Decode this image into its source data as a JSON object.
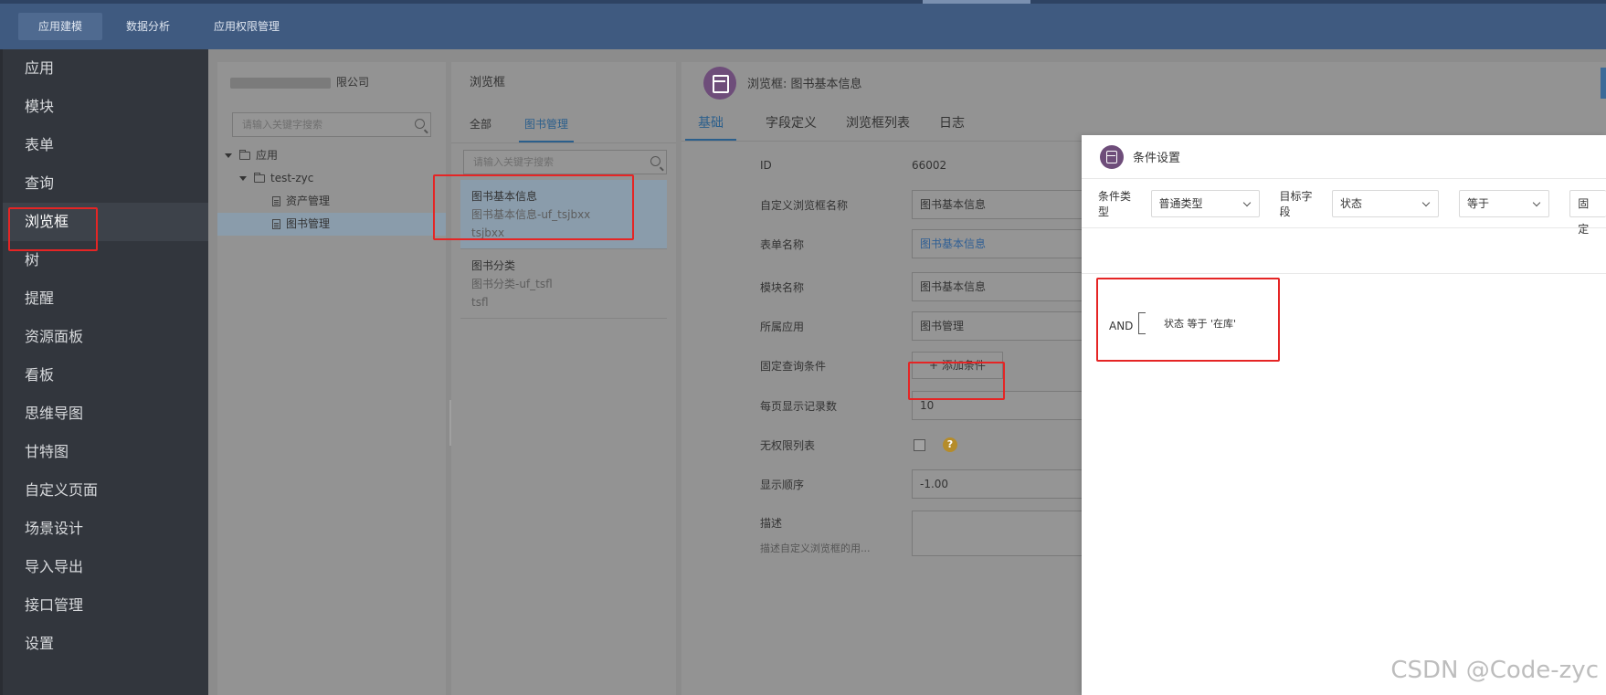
{
  "top_nav": {
    "tabs": [
      {
        "label": "应用建模",
        "active": true
      },
      {
        "label": "数据分析",
        "active": false
      },
      {
        "label": "应用权限管理",
        "active": false
      }
    ]
  },
  "sidebar": {
    "items": [
      {
        "label": "应用"
      },
      {
        "label": "模块"
      },
      {
        "label": "表单"
      },
      {
        "label": "查询"
      },
      {
        "label": "浏览框",
        "active": true
      },
      {
        "label": "树"
      },
      {
        "label": "提醒"
      },
      {
        "label": "资源面板"
      },
      {
        "label": "看板"
      },
      {
        "label": "思维导图"
      },
      {
        "label": "甘特图"
      },
      {
        "label": "自定义页面"
      },
      {
        "label": "场景设计"
      },
      {
        "label": "导入导出"
      },
      {
        "label": "接口管理"
      },
      {
        "label": "设置"
      }
    ]
  },
  "tree_panel": {
    "company_suffix": "限公司",
    "search_placeholder": "请输入关键字搜索",
    "nodes": [
      {
        "label": "应用"
      },
      {
        "label": "test-zyc"
      },
      {
        "label": "资产管理"
      },
      {
        "label": "图书管理"
      }
    ]
  },
  "list_panel": {
    "title": "浏览框",
    "tabs": [
      {
        "label": "全部"
      },
      {
        "label": "图书管理",
        "active": true
      }
    ],
    "search_placeholder": "请输入关键字搜索",
    "items": [
      {
        "name": "图书基本信息",
        "sub": "图书基本信息-uf_tsjbxx",
        "code": "tsjbxx"
      },
      {
        "name": "图书分类",
        "sub": "图书分类-uf_tsfl",
        "code": "tsfl"
      }
    ]
  },
  "main_panel": {
    "title": "浏览框: 图书基本信息",
    "tabs": [
      {
        "label": "基础",
        "active": true
      },
      {
        "label": "字段定义"
      },
      {
        "label": "浏览框列表"
      },
      {
        "label": "日志"
      }
    ],
    "fields": {
      "id_label": "ID",
      "id_value": "66002",
      "name_label": "自定义浏览框名称",
      "name_value": "图书基本信息",
      "form_label": "表单名称",
      "form_value": "图书基本信息",
      "module_label": "模块名称",
      "module_value": "图书基本信息",
      "app_label": "所属应用",
      "app_value": "图书管理",
      "fixed_cond_label": "固定查询条件",
      "add_cond_button": "+ 添加条件",
      "page_size_label": "每页显示记录数",
      "page_size_value": "10",
      "no_perm_label": "无权限列表",
      "no_perm_help": "?",
      "order_label": "显示顺序",
      "order_value": "-1.00",
      "desc_label": "描述",
      "desc_sub": "描述自定义浏览框的用..."
    }
  },
  "modal": {
    "title": "条件设置",
    "cond_type_label": "条件类型",
    "cond_type_value": "普通类型",
    "target_field_label": "目标字段",
    "target_field_value": "状态",
    "operator_value": "等于",
    "fixed_value": "固定",
    "and_label": "AND",
    "condition_text": "状态 等于 '在库'"
  },
  "watermark": "CSDN @Code-zyc",
  "colors": {
    "top_bar": "#3f5a80",
    "sidebar": "#32363d",
    "highlight": "#e52525",
    "accent": "#2b5f8c"
  }
}
